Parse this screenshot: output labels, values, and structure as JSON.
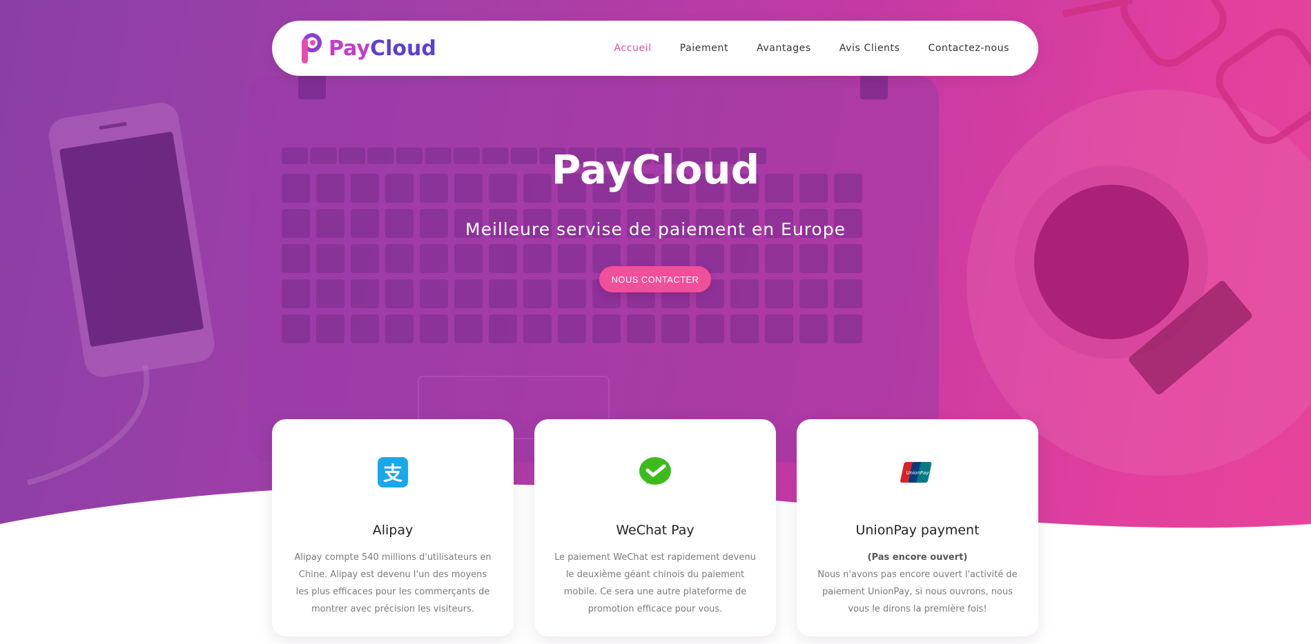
{
  "brand": {
    "name_part1": "Pay",
    "name_part2": "Cloud",
    "pink": "#c03dc9",
    "violet": "#5b3fd6"
  },
  "nav": {
    "items": [
      {
        "label": "Accueil",
        "active": true
      },
      {
        "label": "Paiement"
      },
      {
        "label": "Avantages"
      },
      {
        "label": "Avis Clients"
      },
      {
        "label": "Contactez-nous"
      }
    ]
  },
  "hero": {
    "title": "PayCloud",
    "subtitle": "Meilleure servise de paiement en Europe",
    "cta": "NOUS CONTACTER",
    "gradient_start": "#8a3fa6",
    "gradient_end": "#e8449a",
    "accent": "#f0509a"
  },
  "cards": [
    {
      "icon": "alipay-icon",
      "title": "Alipay",
      "body": "Alipay compte 540 millions d'utilisateurs en Chine. Alipay est devenu l'un des moyens les plus efficaces pour les commerçants de montrer avec précision les visiteurs."
    },
    {
      "icon": "wechat-pay-icon",
      "title": "WeChat Pay",
      "body": "Le paiement WeChat est rapidement devenu le deuxième géant chinois du paiement mobile. Ce sera une autre plateforme de promotion efficace pour vous."
    },
    {
      "icon": "unionpay-icon",
      "title": "UnionPay payment",
      "note": "(Pas encore ouvert)",
      "body": "Nous n'avons pas encore ouvert l'activité de paiement UnionPay, si nous ouvrons, nous vous le dirons la première fois!"
    }
  ]
}
